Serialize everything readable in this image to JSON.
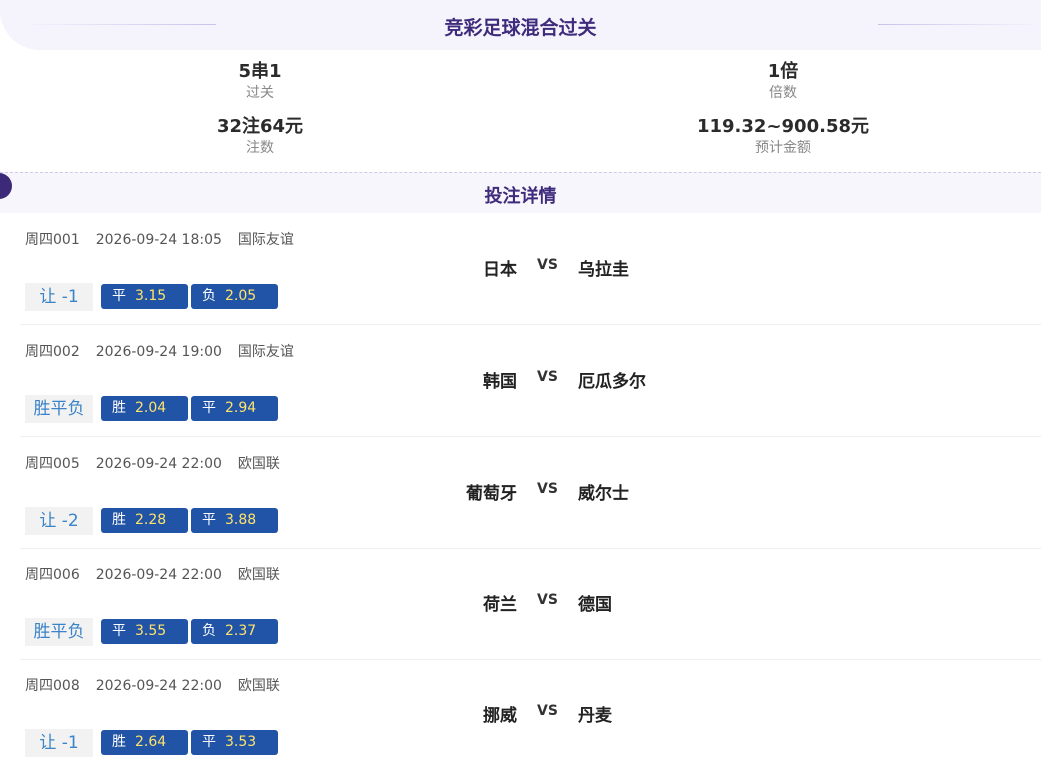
{
  "header": {
    "title": "竞彩足球混合过关"
  },
  "summary": {
    "pass_type": {
      "value": "5串1",
      "label": "过关"
    },
    "multiple": {
      "value": "1倍",
      "label": "倍数"
    },
    "bets": {
      "value": "32注64元",
      "label": "注数"
    },
    "estimate": {
      "value": "119.32~900.58元",
      "label": "预计金额"
    }
  },
  "detail": {
    "title": "投注详情"
  },
  "matches": [
    {
      "code": "周四001",
      "time": "2026-09-24 18:05",
      "league": "国际友谊",
      "home": "日本",
      "vs": "VS",
      "away": "乌拉圭",
      "play": "让 -1",
      "odds": [
        {
          "k": "平",
          "v": "3.15"
        },
        {
          "k": "负",
          "v": "2.05"
        }
      ]
    },
    {
      "code": "周四002",
      "time": "2026-09-24 19:00",
      "league": "国际友谊",
      "home": "韩国",
      "vs": "VS",
      "away": "厄瓜多尔",
      "play": "胜平负",
      "odds": [
        {
          "k": "胜",
          "v": "2.04"
        },
        {
          "k": "平",
          "v": "2.94"
        }
      ]
    },
    {
      "code": "周四005",
      "time": "2026-09-24 22:00",
      "league": "欧国联",
      "home": "葡萄牙",
      "vs": "VS",
      "away": "威尔士",
      "play": "让 -2",
      "odds": [
        {
          "k": "胜",
          "v": "2.28"
        },
        {
          "k": "平",
          "v": "3.88"
        }
      ]
    },
    {
      "code": "周四006",
      "time": "2026-09-24 22:00",
      "league": "欧国联",
      "home": "荷兰",
      "vs": "VS",
      "away": "德国",
      "play": "胜平负",
      "odds": [
        {
          "k": "平",
          "v": "3.55"
        },
        {
          "k": "负",
          "v": "2.37"
        }
      ]
    },
    {
      "code": "周四008",
      "time": "2026-09-24 22:00",
      "league": "欧国联",
      "home": "挪威",
      "vs": "VS",
      "away": "丹麦",
      "play": "让 -1",
      "odds": [
        {
          "k": "胜",
          "v": "2.64"
        },
        {
          "k": "平",
          "v": "3.53"
        }
      ]
    }
  ],
  "colors": {
    "accent": "#3f2b7c",
    "odds_bg": "#2154a6",
    "odds_value": "#ffe46b",
    "play_text": "#3a83c8"
  }
}
